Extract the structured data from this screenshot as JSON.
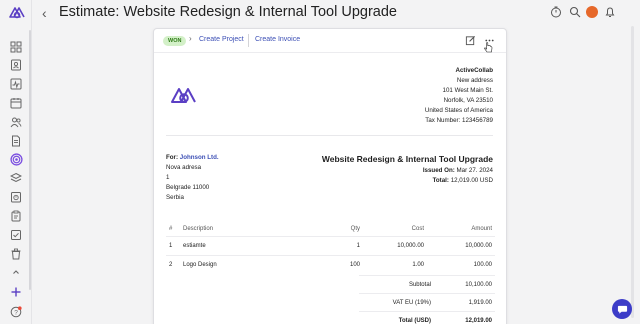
{
  "page": {
    "title": "Estimate: Website Redesign & Internal Tool Upgrade"
  },
  "sidebar": {
    "icons": [
      "dashboard-icon",
      "contacts-icon",
      "activity-icon",
      "calendar-icon",
      "people-icon",
      "document-icon",
      "target-icon",
      "layers-icon",
      "timer-icon",
      "clipboard-icon",
      "checklist-icon",
      "trash-icon",
      "chevron-up-icon",
      "plus-icon",
      "help-icon"
    ],
    "active_icon": "target-icon",
    "accent": "#7b4fe0"
  },
  "topbar": {
    "icons": [
      "stopwatch-icon",
      "search-icon",
      "avatar",
      "bell-icon"
    ]
  },
  "card_header": {
    "status_badge": "WON",
    "create_project": "Create Project",
    "create_invoice": "Create Invoice"
  },
  "company": {
    "name": "ActiveCollab",
    "address1": "New address",
    "address2": "101 West Main St.",
    "address3": "Norfolk, VA 23510",
    "country": "United States of America",
    "tax": "Tax Number: 123456789"
  },
  "client": {
    "for_label": "For:",
    "name": "Johnson Ltd.",
    "line1": "Nova adresa",
    "line2": "1",
    "line3": "Belgrade 11000",
    "line4": "Serbia"
  },
  "estimate": {
    "title": "Website Redesign & Internal Tool Upgrade",
    "issued_label": "Issued On:",
    "issued_value": "Mar 27. 2024",
    "total_label": "Total:",
    "total_value": "12,019.00 USD"
  },
  "table": {
    "headers": {
      "num": "#",
      "desc": "Description",
      "qty": "Qty",
      "cost": "Cost",
      "amount": "Amount"
    },
    "rows": [
      {
        "num": "1",
        "desc": "estiamte",
        "qty": "1",
        "cost": "10,000.00",
        "amount": "10,000.00"
      },
      {
        "num": "2",
        "desc": "Logo Design",
        "qty": "100",
        "cost": "1.00",
        "amount": "100.00"
      }
    ]
  },
  "totals": {
    "subtotal_label": "Subtotal",
    "subtotal_value": "10,100.00",
    "vat_label": "VAT EU (19%)",
    "vat_value": "1,919.00",
    "total_label": "Total (USD)",
    "total_value": "12,019.00"
  }
}
